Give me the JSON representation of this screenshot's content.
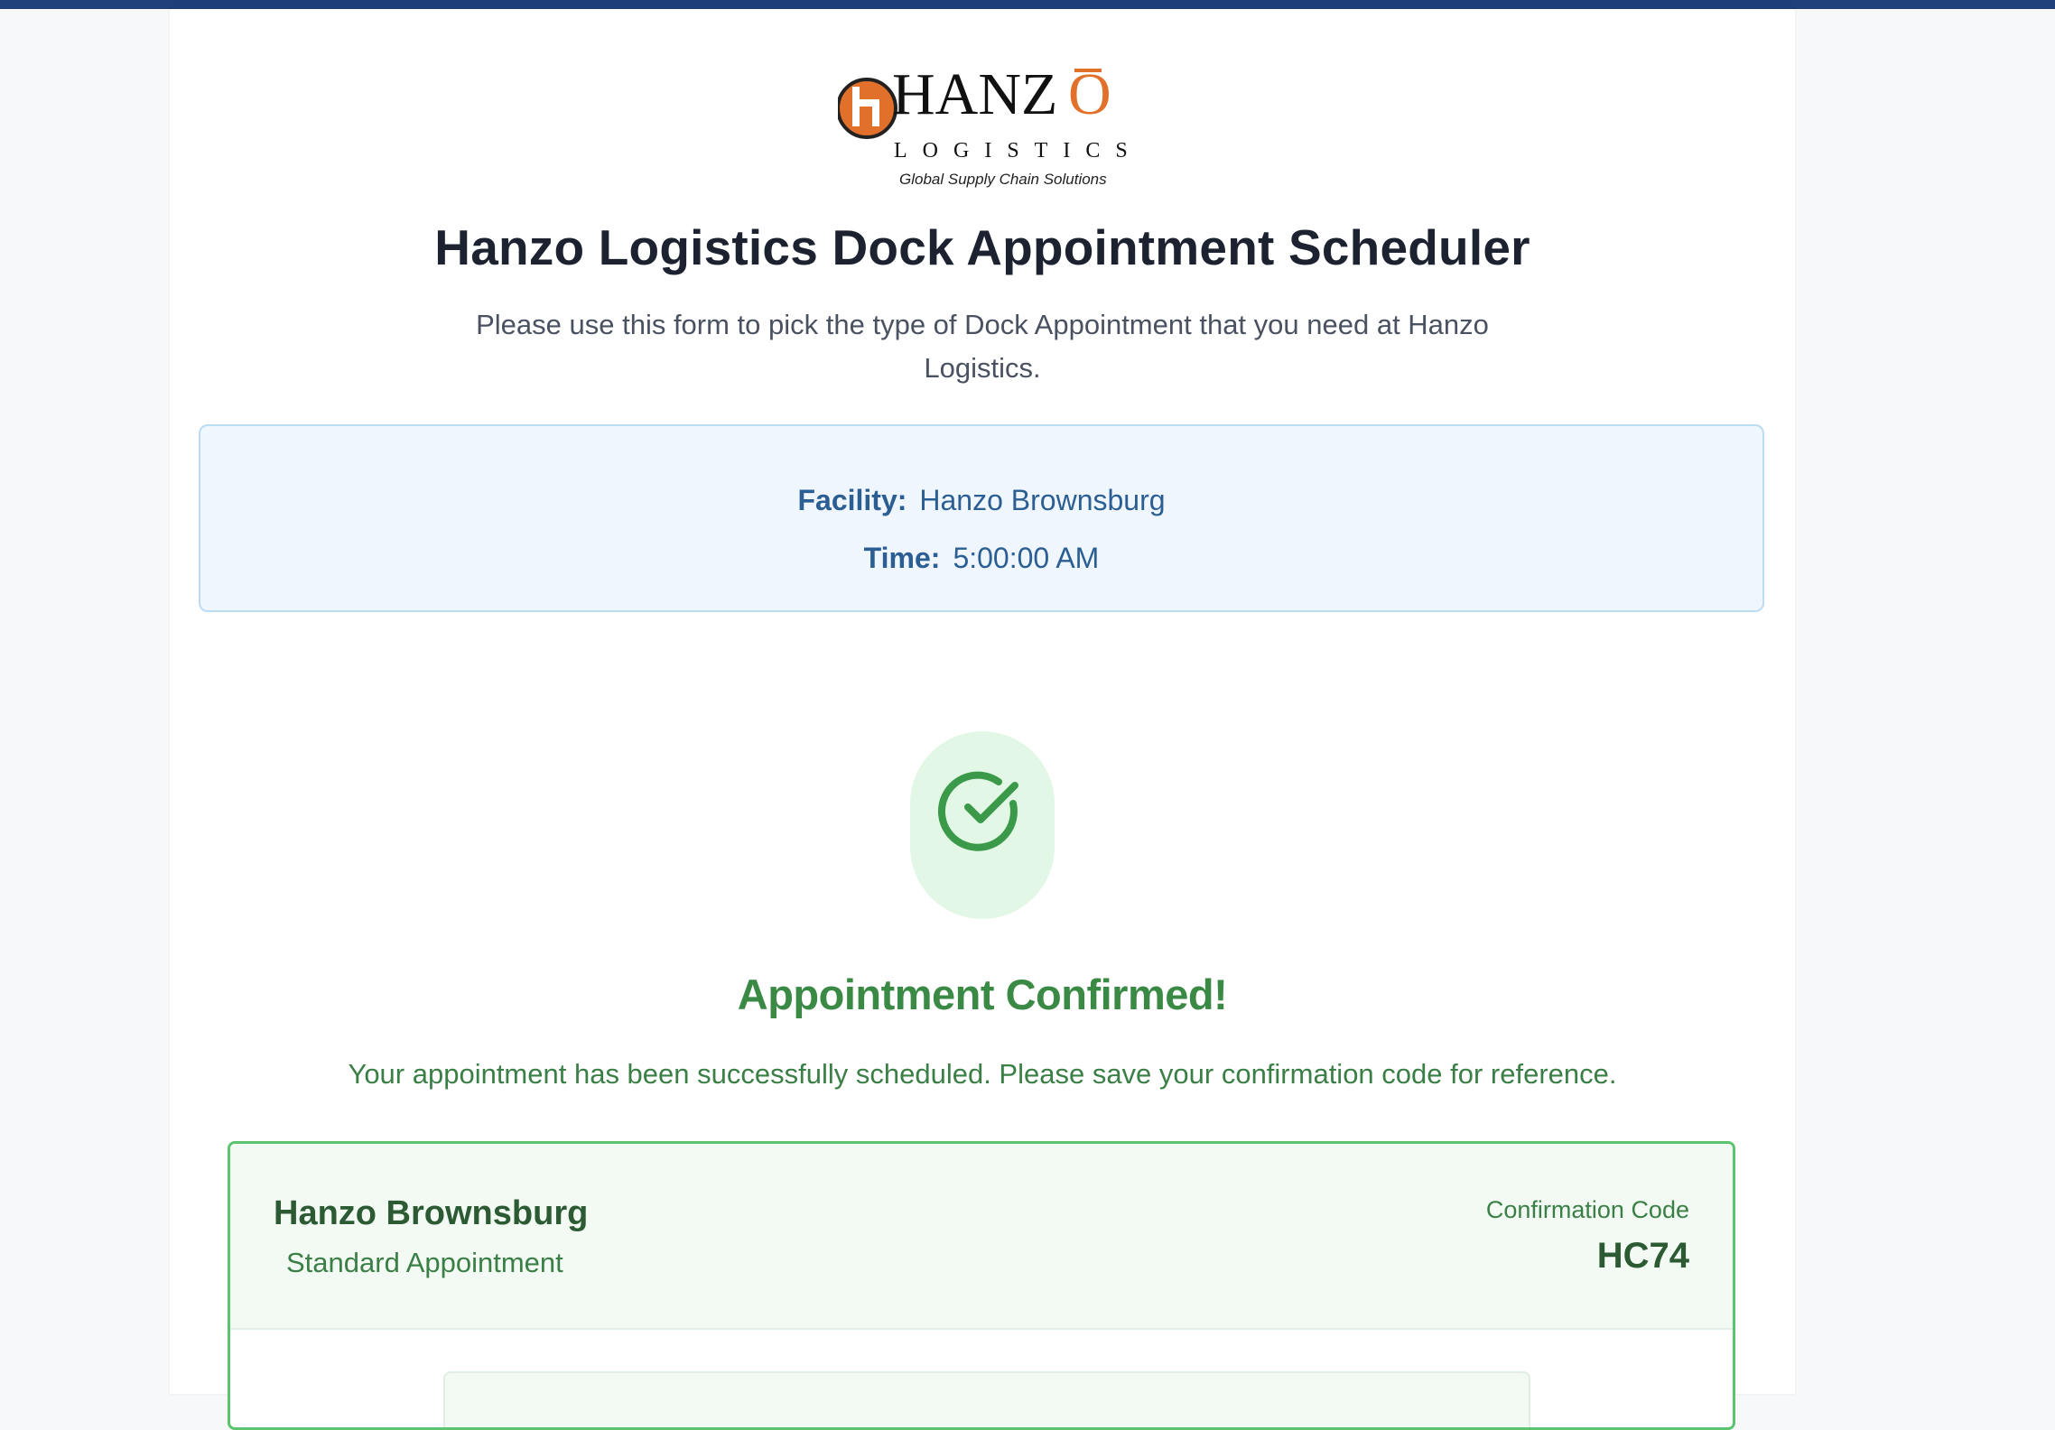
{
  "brand": {
    "logo_name": "HANZŌ",
    "logo_sub": "LOGISTICS",
    "logo_tagline": "Global Supply Chain Solutions",
    "accent_color": "#e1702a",
    "top_bar_color": "#1e3f7a"
  },
  "header": {
    "title": "Hanzo Logistics Dock Appointment Scheduler",
    "subtitle": "Please use this form to pick the type of Dock Appointment that you need at Hanzo Logistics."
  },
  "info": {
    "facility_label": "Facility:",
    "facility_value": "Hanzo Brownsburg",
    "time_label": "Time:",
    "time_value": "5:00:00 AM"
  },
  "confirmation": {
    "icon": "check-circle-icon",
    "title": "Appointment Confirmed!",
    "message": "Your appointment has been successfully scheduled. Please save your confirmation code for reference.",
    "facility": "Hanzo Brownsburg",
    "appointment_type": "Standard Appointment",
    "code_label": "Confirmation Code",
    "code": "HC74",
    "success_color": "#3a8a45"
  }
}
